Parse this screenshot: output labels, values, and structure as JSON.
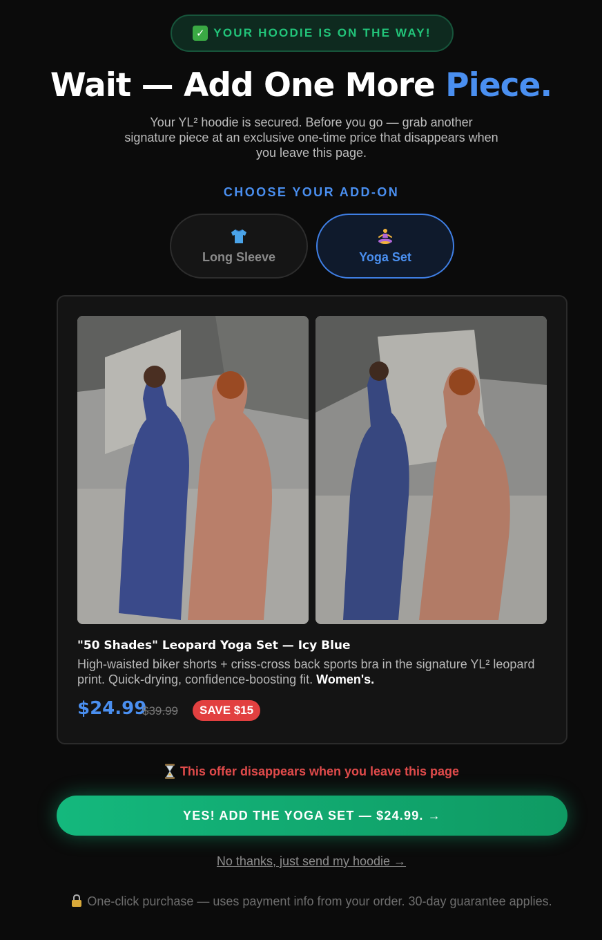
{
  "badge": {
    "icon": "check-icon",
    "text": "YOUR HOODIE IS ON THE WAY!"
  },
  "headline": {
    "main": "Wait — Add One More ",
    "accent": "Piece."
  },
  "subtext": "Your YL² hoodie is secured. Before you go — grab another signature piece at an exclusive one-time price that disappears when you leave this page.",
  "chooser": {
    "heading": "CHOOSE YOUR ADD-ON",
    "options": [
      {
        "icon": "tshirt-icon",
        "label": "Long Sleeve",
        "selected": false
      },
      {
        "icon": "yoga-icon",
        "label": "Yoga Set",
        "selected": true
      }
    ]
  },
  "product": {
    "title": "\"50 Shades\" Leopard Yoga Set — Icy Blue",
    "description": "High-waisted biker shorts + criss-cross back sports bra in the signature YL² leopard print. Quick-drying, confidence-boosting fit. ",
    "description_bold": "Women's.",
    "price": "$24.99",
    "old_price": "$39.99",
    "save_badge": "SAVE $15"
  },
  "warning": {
    "icon": "hourglass-icon",
    "text": "This offer disappears when you leave this page"
  },
  "cta_label": "YES! ADD THE YOGA SET — $24.99. →",
  "decline_label": "No thanks, just send my hoodie →",
  "footer": {
    "icon": "lock-icon",
    "text": "One-click purchase — uses payment info from your order. 30-day guarantee applies."
  },
  "colors": {
    "accent": "#4a8ff0",
    "success": "#22c57a",
    "danger": "#e14b4b",
    "cta": "#14b87d"
  }
}
